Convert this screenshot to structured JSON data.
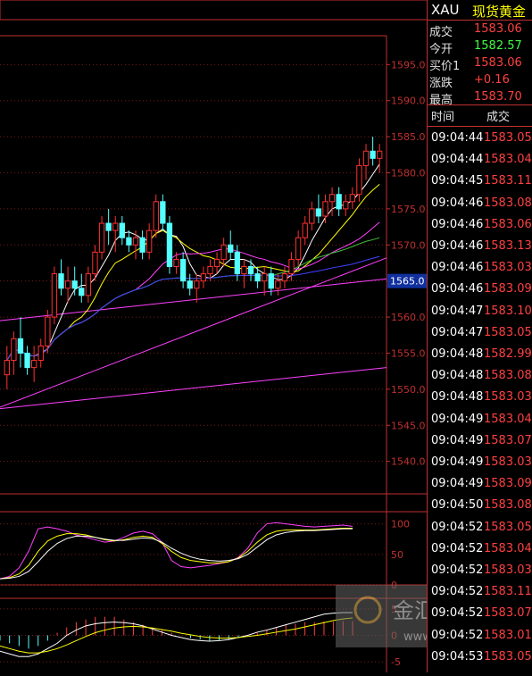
{
  "chart_data": [
    {
      "type": "candlestick",
      "panel": "price",
      "y_ticks": [
        "1595.0",
        "1590.0",
        "1585.0",
        "1580.0",
        "1575.0",
        "1570.0",
        "1565.0",
        "1560.0",
        "1555.0",
        "1550.0",
        "1545.0",
        "1540.0"
      ],
      "ylim": [
        1535.5,
        1599.0
      ],
      "current_price_label": "1565.0",
      "candles": [
        {
          "o": 1552,
          "h": 1556,
          "l": 1550,
          "c": 1554
        },
        {
          "o": 1554,
          "h": 1558,
          "l": 1552,
          "c": 1557
        },
        {
          "o": 1557,
          "h": 1560,
          "l": 1553,
          "c": 1555
        },
        {
          "o": 1555,
          "h": 1556,
          "l": 1552,
          "c": 1553
        },
        {
          "o": 1553,
          "h": 1556,
          "l": 1551,
          "c": 1554
        },
        {
          "o": 1554,
          "h": 1557,
          "l": 1553,
          "c": 1556
        },
        {
          "o": 1556,
          "h": 1561,
          "l": 1555,
          "c": 1560
        },
        {
          "o": 1560,
          "h": 1567,
          "l": 1559,
          "c": 1566
        },
        {
          "o": 1566,
          "h": 1568,
          "l": 1563,
          "c": 1564
        },
        {
          "o": 1564,
          "h": 1567,
          "l": 1562,
          "c": 1565
        },
        {
          "o": 1565,
          "h": 1567,
          "l": 1563,
          "c": 1564
        },
        {
          "o": 1564,
          "h": 1566,
          "l": 1562,
          "c": 1563
        },
        {
          "o": 1563,
          "h": 1567,
          "l": 1562,
          "c": 1566
        },
        {
          "o": 1566,
          "h": 1570,
          "l": 1565,
          "c": 1569
        },
        {
          "o": 1569,
          "h": 1574,
          "l": 1568,
          "c": 1573
        },
        {
          "o": 1573,
          "h": 1575,
          "l": 1570,
          "c": 1572
        },
        {
          "o": 1572,
          "h": 1574,
          "l": 1569,
          "c": 1573
        },
        {
          "o": 1573,
          "h": 1574,
          "l": 1570,
          "c": 1571
        },
        {
          "o": 1571,
          "h": 1572,
          "l": 1569,
          "c": 1570
        },
        {
          "o": 1570,
          "h": 1572,
          "l": 1568,
          "c": 1571
        },
        {
          "o": 1571,
          "h": 1572,
          "l": 1568,
          "c": 1569
        },
        {
          "o": 1569,
          "h": 1573,
          "l": 1568,
          "c": 1572
        },
        {
          "o": 1572,
          "h": 1577,
          "l": 1571,
          "c": 1576
        },
        {
          "o": 1576,
          "h": 1577,
          "l": 1572,
          "c": 1573
        },
        {
          "o": 1573,
          "h": 1574,
          "l": 1566,
          "c": 1567
        },
        {
          "o": 1567,
          "h": 1569,
          "l": 1566,
          "c": 1568
        },
        {
          "o": 1568,
          "h": 1569,
          "l": 1564,
          "c": 1565
        },
        {
          "o": 1565,
          "h": 1566,
          "l": 1563,
          "c": 1564
        },
        {
          "o": 1564,
          "h": 1566,
          "l": 1562,
          "c": 1565
        },
        {
          "o": 1565,
          "h": 1567,
          "l": 1564,
          "c": 1566
        },
        {
          "o": 1566,
          "h": 1568,
          "l": 1565,
          "c": 1567
        },
        {
          "o": 1567,
          "h": 1569,
          "l": 1566,
          "c": 1568
        },
        {
          "o": 1568,
          "h": 1571,
          "l": 1567,
          "c": 1570
        },
        {
          "o": 1570,
          "h": 1572,
          "l": 1568,
          "c": 1569
        },
        {
          "o": 1569,
          "h": 1570,
          "l": 1565,
          "c": 1566
        },
        {
          "o": 1566,
          "h": 1568,
          "l": 1564,
          "c": 1567
        },
        {
          "o": 1567,
          "h": 1568,
          "l": 1565,
          "c": 1566
        },
        {
          "o": 1566,
          "h": 1567,
          "l": 1564,
          "c": 1565
        },
        {
          "o": 1565,
          "h": 1567,
          "l": 1563,
          "c": 1566
        },
        {
          "o": 1566,
          "h": 1567,
          "l": 1563,
          "c": 1564
        },
        {
          "o": 1564,
          "h": 1566,
          "l": 1563,
          "c": 1565
        },
        {
          "o": 1565,
          "h": 1567,
          "l": 1564,
          "c": 1566
        },
        {
          "o": 1566,
          "h": 1569,
          "l": 1565,
          "c": 1568
        },
        {
          "o": 1568,
          "h": 1572,
          "l": 1567,
          "c": 1571
        },
        {
          "o": 1571,
          "h": 1574,
          "l": 1570,
          "c": 1573
        },
        {
          "o": 1573,
          "h": 1576,
          "l": 1572,
          "c": 1575
        },
        {
          "o": 1575,
          "h": 1577,
          "l": 1573,
          "c": 1574
        },
        {
          "o": 1574,
          "h": 1577,
          "l": 1573,
          "c": 1576
        },
        {
          "o": 1576,
          "h": 1578,
          "l": 1574,
          "c": 1577
        },
        {
          "o": 1577,
          "h": 1578,
          "l": 1574,
          "c": 1575
        },
        {
          "o": 1575,
          "h": 1577,
          "l": 1574,
          "c": 1576
        },
        {
          "o": 1576,
          "h": 1578,
          "l": 1575,
          "c": 1577
        },
        {
          "o": 1577,
          "h": 1582,
          "l": 1576,
          "c": 1581
        },
        {
          "o": 1581,
          "h": 1584,
          "l": 1579,
          "c": 1583
        },
        {
          "o": 1583,
          "h": 1585,
          "l": 1581,
          "c": 1582
        },
        {
          "o": 1582,
          "h": 1584,
          "l": 1580,
          "c": 1583
        }
      ],
      "bull_color": "#ff3030",
      "bear_color": "#54ffff"
    },
    {
      "type": "line",
      "panel": "oscillator",
      "y_ticks": [
        "100",
        "50",
        "0"
      ],
      "ylim": [
        0,
        120
      ],
      "series": [
        {
          "color": "#ff40ff",
          "values": [
            10,
            14,
            28,
            55,
            92,
            95,
            92,
            88,
            82,
            78,
            74,
            70,
            72,
            78,
            85,
            88,
            84,
            70,
            40,
            30,
            28,
            30,
            32,
            35,
            38,
            45,
            60,
            85,
            100,
            102,
            100,
            98,
            96,
            95,
            96,
            97,
            98,
            96
          ]
        },
        {
          "color": "#ffff00",
          "values": [
            10,
            12,
            18,
            32,
            55,
            72,
            80,
            84,
            84,
            82,
            78,
            74,
            72,
            74,
            78,
            80,
            78,
            68,
            55,
            45,
            40,
            38,
            36,
            36,
            38,
            44,
            55,
            70,
            82,
            88,
            90,
            90,
            90,
            90,
            91,
            92,
            93,
            93
          ]
        },
        {
          "color": "#ffffff",
          "values": [
            10,
            11,
            14,
            22,
            38,
            55,
            68,
            76,
            80,
            80,
            78,
            75,
            73,
            73,
            75,
            77,
            76,
            70,
            60,
            52,
            46,
            42,
            40,
            39,
            40,
            43,
            50,
            62,
            74,
            82,
            86,
            88,
            89,
            89,
            90,
            91,
            92,
            92
          ]
        }
      ]
    },
    {
      "type": "bar+line",
      "panel": "macd",
      "y_ticks": [
        "5",
        "0",
        "-5"
      ],
      "ylim": [
        -7,
        7
      ],
      "histogram": [
        -1,
        -1.5,
        -2,
        -2.5,
        -2,
        -1,
        0.5,
        1.5,
        2.5,
        3,
        3.5,
        3.5,
        3.5,
        3,
        2.5,
        2,
        1.5,
        1,
        0.5,
        0,
        -0.5,
        -0.8,
        -1,
        -1,
        -0.8,
        -0.5,
        0,
        0.5,
        1,
        1.5,
        2,
        2.2,
        2.5,
        2.5,
        2.6,
        2.6,
        2.7,
        2.7
      ],
      "series": [
        {
          "color": "#ffffff",
          "values": [
            -3,
            -3.5,
            -4,
            -4,
            -3.5,
            -2.5,
            -1.5,
            0,
            1,
            1.8,
            2.2,
            2.4,
            2.5,
            2.4,
            2.2,
            1.8,
            1.2,
            0.6,
            0,
            -0.4,
            -0.8,
            -1,
            -1.1,
            -1,
            -0.8,
            -0.4,
            0,
            0.6,
            1,
            1.5,
            2,
            2.5,
            3,
            3.5,
            4,
            4.2,
            4.3,
            4.3
          ]
        },
        {
          "color": "#ffff00",
          "values": [
            -2,
            -2.5,
            -3,
            -3.3,
            -3.3,
            -3,
            -2.5,
            -1.8,
            -1,
            -0.2,
            0.5,
            1,
            1.4,
            1.6,
            1.7,
            1.6,
            1.4,
            1.1,
            0.8,
            0.4,
            0.1,
            -0.2,
            -0.4,
            -0.5,
            -0.5,
            -0.4,
            -0.2,
            0,
            0.3,
            0.6,
            0.9,
            1.2,
            1.6,
            2,
            2.4,
            2.8,
            3.1,
            3.3
          ]
        }
      ]
    }
  ],
  "quote": {
    "symbol": "XAU",
    "name": "现货黄金",
    "rows": [
      {
        "label": "成交",
        "value": "1583.06",
        "color": "#ff4040"
      },
      {
        "label": "今开",
        "value": "1582.57",
        "color": "#40ff40"
      },
      {
        "label": "买价1",
        "value": "1583.06",
        "color": "#ff4040"
      },
      {
        "label": "涨跌",
        "value": "+0.16",
        "color": "#ff4040"
      },
      {
        "label": "最高",
        "value": "1583.70",
        "color": "#ff4040"
      }
    ]
  },
  "ticks": {
    "header_time": "时间",
    "header_price": "成交",
    "rows": [
      {
        "time": "09:04:44",
        "price": "1583.05"
      },
      {
        "time": "09:04:44",
        "price": "1583.04"
      },
      {
        "time": "09:04:45",
        "price": "1583.11"
      },
      {
        "time": "09:04:46",
        "price": "1583.08"
      },
      {
        "time": "09:04:46",
        "price": "1583.06"
      },
      {
        "time": "09:04:46",
        "price": "1583.13"
      },
      {
        "time": "09:04:46",
        "price": "1583.03"
      },
      {
        "time": "09:04:46",
        "price": "1583.09"
      },
      {
        "time": "09:04:47",
        "price": "1583.10"
      },
      {
        "time": "09:04:47",
        "price": "1583.05"
      },
      {
        "time": "09:04:48",
        "price": "1582.99"
      },
      {
        "time": "09:04:48",
        "price": "1583.08"
      },
      {
        "time": "09:04:48",
        "price": "1583.03"
      },
      {
        "time": "09:04:49",
        "price": "1583.04"
      },
      {
        "time": "09:04:49",
        "price": "1583.07"
      },
      {
        "time": "09:04:49",
        "price": "1583.03"
      },
      {
        "time": "09:04:49",
        "price": "1583.09"
      },
      {
        "time": "09:04:50",
        "price": "1583.08"
      },
      {
        "time": "09:04:52",
        "price": "1583.05"
      },
      {
        "time": "09:04:52",
        "price": "1583.04"
      },
      {
        "time": "09:04:52",
        "price": "1583.03"
      },
      {
        "time": "09:04:52",
        "price": "1583.11"
      },
      {
        "time": "09:04:52",
        "price": "1583.07"
      },
      {
        "time": "09:04:52",
        "price": "1583.01"
      },
      {
        "time": "09:04:53",
        "price": "1583.05"
      }
    ]
  },
  "watermark": {
    "text": "金汇网",
    "url": "www.jrwei.com"
  }
}
